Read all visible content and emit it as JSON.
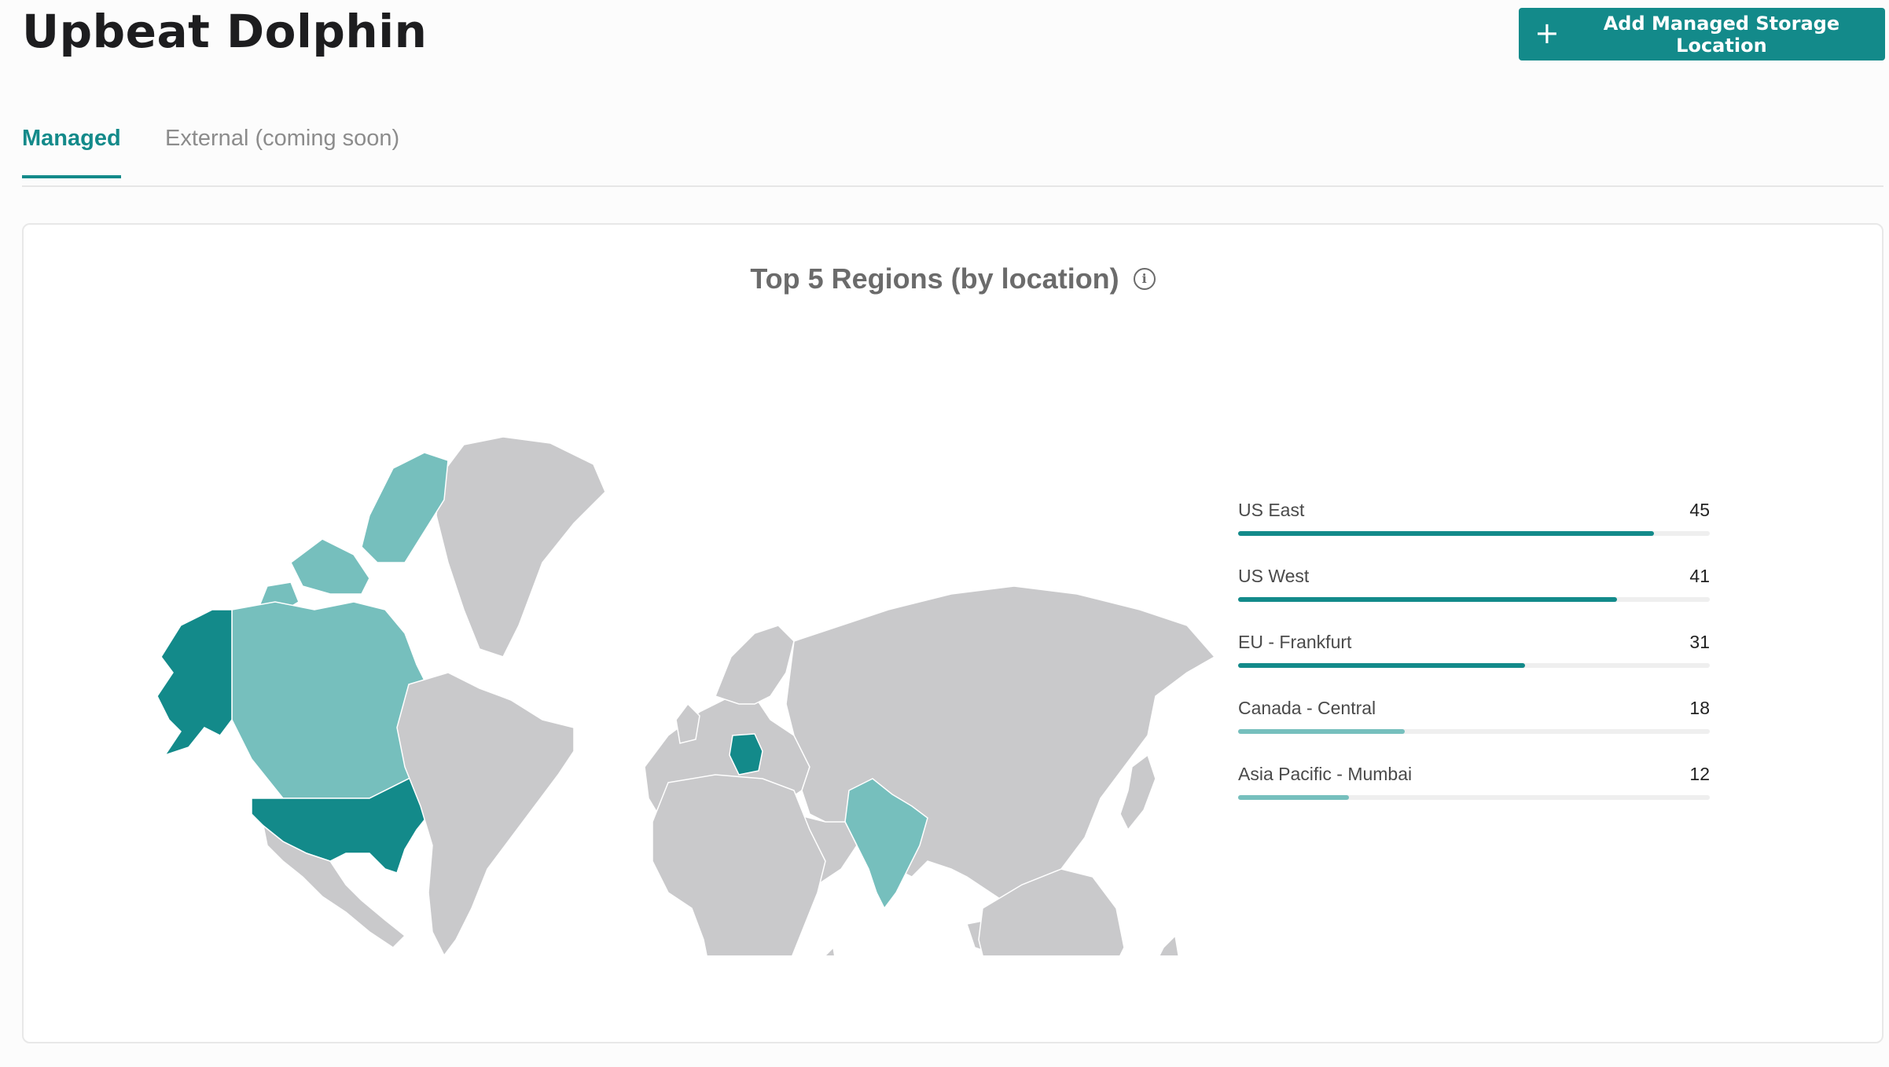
{
  "header": {
    "title": "Upbeat Dolphin",
    "add_button_label": "Add Managed Storage Location"
  },
  "tabs": [
    {
      "label": "Managed",
      "active": true
    },
    {
      "label": "External (coming soon)",
      "active": false
    }
  ],
  "card": {
    "title": "Top 5 Regions (by location)"
  },
  "colors": {
    "accent": "#138a8a",
    "light_accent": "#76bfbd",
    "land": "#c9c9cb"
  },
  "legend_scale_max": 51,
  "regions": [
    {
      "label": "US East",
      "value": 45,
      "color": "#138a8a"
    },
    {
      "label": "US West",
      "value": 41,
      "color": "#138a8a"
    },
    {
      "label": "EU - Frankfurt",
      "value": 31,
      "color": "#138a8a"
    },
    {
      "label": "Canada - Central",
      "value": 18,
      "color": "#76bfbd"
    },
    {
      "label": "Asia Pacific - Mumbai",
      "value": 12,
      "color": "#76bfbd"
    }
  ]
}
